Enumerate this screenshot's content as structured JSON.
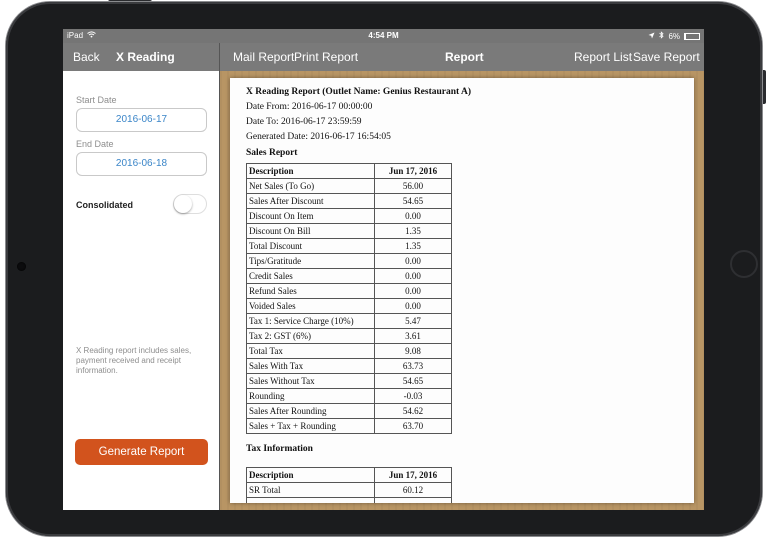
{
  "status_bar": {
    "device": "iPad",
    "time": "4:54 PM",
    "battery_label": "6%",
    "battery_level": 0.06
  },
  "nav": {
    "back_label": "Back",
    "left_title": "X Reading",
    "mail_report": "Mail Report",
    "print_report": "Print Report",
    "center_title": "Report",
    "report_list": "Report List",
    "save_report": "Save Report"
  },
  "form": {
    "start_date_label": "Start Date",
    "start_date_value": "2016-06-17",
    "end_date_label": "End Date",
    "end_date_value": "2016-06-18",
    "consolidated_label": "Consolidated",
    "consolidated_on": false,
    "info_text": "X Reading report includes sales, payment received and receipt information.",
    "generate_label": "Generate Report"
  },
  "colors": {
    "accent_button": "#d2531d",
    "date_text": "#3a85c8",
    "nav_bar": "#7a7a7a"
  },
  "report": {
    "title": "X Reading Report (Outlet Name: Genius Restaurant A)",
    "date_from": "Date From: 2016-06-17 00:00:00",
    "date_to": "Date To: 2016-06-17 23:59:59",
    "generated": "Generated Date: 2016-06-17 16:54:05",
    "sales_heading": "Sales Report",
    "col_description": "Description",
    "col_date": "Jun 17, 2016",
    "sales_rows": [
      {
        "desc": "Net Sales (To Go)",
        "value": "56.00"
      },
      {
        "desc": "Sales After Discount",
        "value": "54.65"
      },
      {
        "desc": "Discount On Item",
        "value": "0.00"
      },
      {
        "desc": "Discount On Bill",
        "value": "1.35"
      },
      {
        "desc": "Total Discount",
        "value": "1.35"
      },
      {
        "desc": "Tips/Gratitude",
        "value": "0.00"
      },
      {
        "desc": "Credit Sales",
        "value": "0.00"
      },
      {
        "desc": "Refund Sales",
        "value": "0.00"
      },
      {
        "desc": "Voided Sales",
        "value": "0.00"
      },
      {
        "desc": "Tax 1: Service Charge (10%)",
        "value": "5.47"
      },
      {
        "desc": "Tax 2: GST (6%)",
        "value": "3.61"
      },
      {
        "desc": "Total Tax",
        "value": "9.08"
      },
      {
        "desc": "Sales With Tax",
        "value": "63.73"
      },
      {
        "desc": "Sales Without Tax",
        "value": "54.65"
      },
      {
        "desc": "Rounding",
        "value": "-0.03"
      },
      {
        "desc": "Sales After Rounding",
        "value": "54.62"
      },
      {
        "desc": "Sales + Tax + Rounding",
        "value": "63.70"
      }
    ],
    "tax_heading": "Tax Information",
    "tax_rows": [
      {
        "desc": "SR Total",
        "value": "60.12"
      },
      {
        "desc": "",
        "value": ""
      }
    ]
  }
}
